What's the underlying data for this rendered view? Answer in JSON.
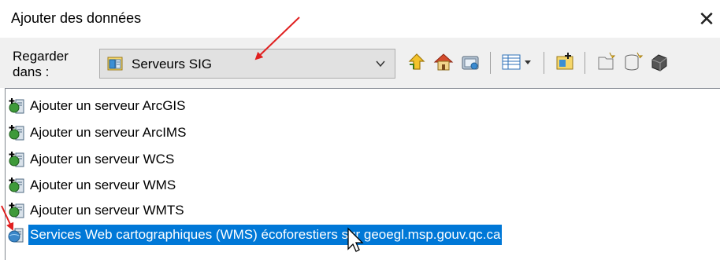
{
  "window": {
    "title": "Ajouter des données",
    "close_glyph": "✕"
  },
  "toolbar": {
    "look_in_label": "Regarder dans :",
    "location_value": "Serveurs SIG",
    "location_icon": "gis-servers-icon",
    "buttons": [
      "up-one-level-icon",
      "home-icon",
      "catalog-connect-icon",
      "view-menu-icon",
      "new-connection-icon",
      "new-folder-icon",
      "new-database-icon",
      "tools-icon"
    ]
  },
  "list": {
    "items": [
      {
        "label": "Ajouter un serveur ArcGIS",
        "icon": "add-server-icon",
        "selected": false
      },
      {
        "label": "Ajouter un serveur ArcIMS",
        "icon": "add-server-icon",
        "selected": false
      },
      {
        "label": "Ajouter un serveur WCS",
        "icon": "add-server-icon",
        "selected": false
      },
      {
        "label": "Ajouter un serveur WMS",
        "icon": "add-server-icon",
        "selected": false
      },
      {
        "label": "Ajouter un serveur WMTS",
        "icon": "add-server-icon",
        "selected": false
      },
      {
        "label": "Services Web cartographiques (WMS) écoforestiers sur geoegl.msp.gouv.qc.ca",
        "icon": "wms-server-icon",
        "selected": true
      }
    ]
  },
  "colors": {
    "selection": "#0078d7",
    "annotation_arrow": "#e02020",
    "toolbar_bg": "#f0f0f0"
  }
}
